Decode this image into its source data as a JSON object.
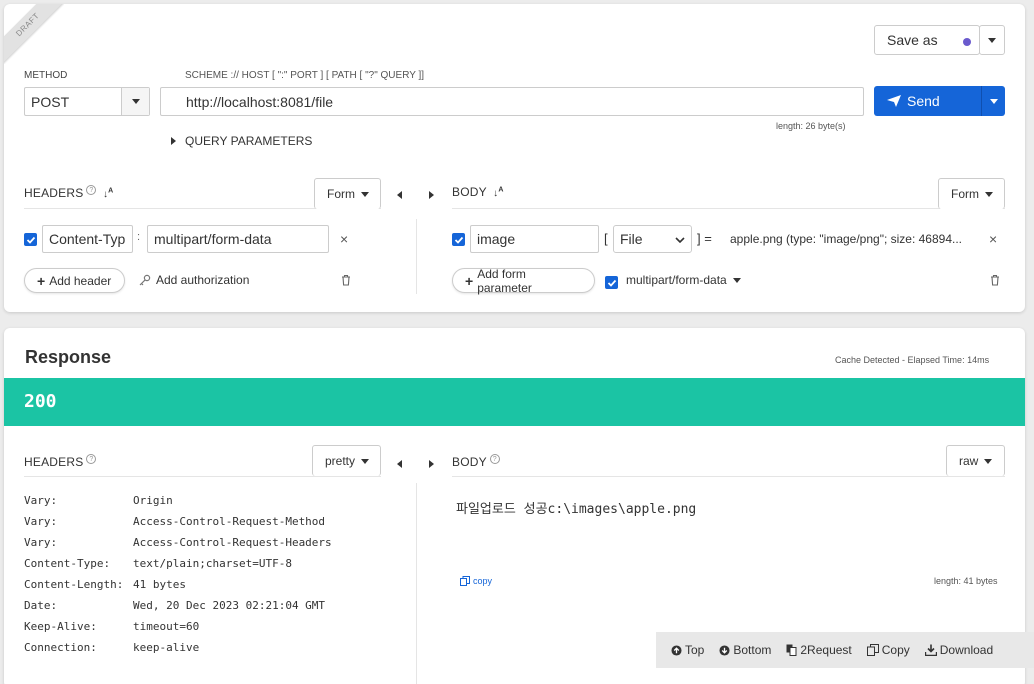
{
  "request": {
    "draft_label": "DRAFT",
    "save_as_label": "Save as",
    "method_label": "METHOD",
    "method_value": "POST",
    "scheme_hint": "SCHEME :// HOST [ \":\" PORT ] [ PATH [ \"?\" QUERY ]]",
    "url_value": "http://localhost:8081/file",
    "send_label": "Send",
    "url_length": "length: 26 byte(s)",
    "query_params_label": "QUERY PARAMETERS",
    "headers": {
      "title": "HEADERS",
      "format": "Form",
      "name": "Content-Typ",
      "value": "multipart/form-data",
      "add_header": "Add header",
      "add_authorization": "Add authorization"
    },
    "body": {
      "title": "BODY",
      "format": "Form",
      "param_name": "image",
      "param_type": "File",
      "param_value": "apple.png (type: \"image/png\"; size: 46894...",
      "add_form_param": "Add form parameter",
      "encoding": "multipart/form-data"
    }
  },
  "response": {
    "title": "Response",
    "timing": "Cache Detected - Elapsed Time: 14ms",
    "status_code": "200",
    "headers_title": "HEADERS",
    "headers_format": "pretty",
    "body_title": "BODY",
    "body_format": "raw",
    "body_text": "파일업로드 성공c:\\images\\apple.png",
    "copy_label": "copy",
    "body_length": "length: 41 bytes",
    "headers": [
      {
        "key": "Vary:",
        "value": "Origin"
      },
      {
        "key": "Vary:",
        "value": "Access-Control-Request-Method"
      },
      {
        "key": "Vary:",
        "value": "Access-Control-Request-Headers"
      },
      {
        "key": "Content-Type:",
        "value": "text/plain;charset=UTF-8"
      },
      {
        "key": "Content-Length:",
        "value": "41 bytes"
      },
      {
        "key": "Date:",
        "value": "Wed, 20 Dec 2023 02:21:04 GMT"
      },
      {
        "key": "Keep-Alive:",
        "value": "timeout=60"
      },
      {
        "key": "Connection:",
        "value": "keep-alive"
      }
    ]
  },
  "toolbar": {
    "top": "Top",
    "bottom": "Bottom",
    "to_request": "2Request",
    "copy": "Copy",
    "download": "Download"
  },
  "colors": {
    "accent": "#1565d8",
    "status_ok": "#1bc4a4",
    "save_dot": "#6a5acd"
  }
}
